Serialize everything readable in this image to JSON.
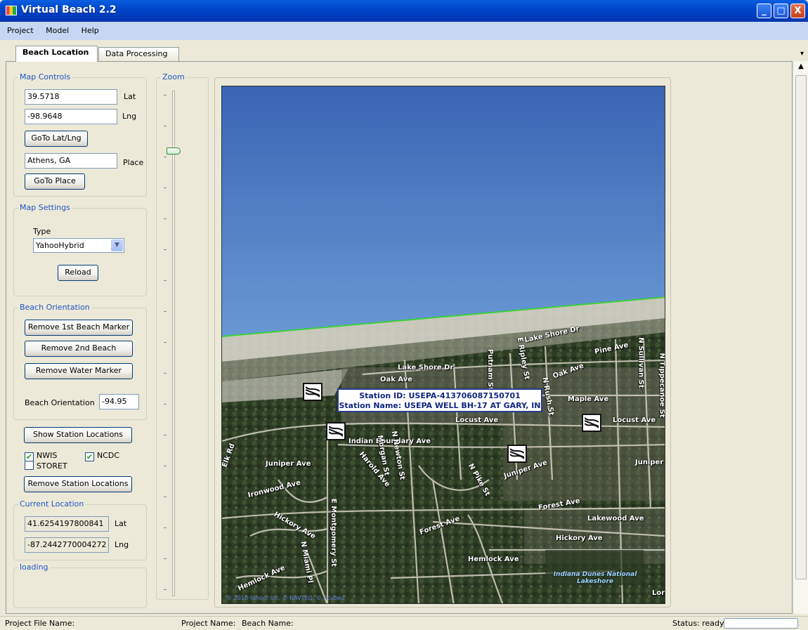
{
  "window": {
    "title": "Virtual Beach 2.2",
    "controls": [
      "_",
      "□",
      "X"
    ]
  },
  "menu": [
    "Project",
    "Model",
    "Help"
  ],
  "tabs": {
    "beach_location": "Beach Location",
    "data_processing": "Data Processing",
    "dropdown": "▾"
  },
  "map_controls": {
    "legend": "Map Controls",
    "lat_value": "39.5718",
    "lat_label": "Lat",
    "lng_value": "-98.9648",
    "lng_label": "Lng",
    "goto_latlng": "GoTo Lat/Lng",
    "place_value": "Athens, GA",
    "place_label": "Place",
    "goto_place": "GoTo Place"
  },
  "zoom": {
    "legend": "Zoom",
    "level_fraction": 0.12
  },
  "map_settings": {
    "legend": "Map Settings",
    "type_label": "Type",
    "type_value": "YahooHybrid",
    "reload": "Reload"
  },
  "beach_orientation": {
    "legend": "Beach Orientation",
    "remove_first": "Remove 1st Beach Marker",
    "remove_second": "Remove 2nd Beach",
    "remove_water": "Remove Water Marker",
    "orientation_label": "Beach Orientation",
    "orientation_value": "-94.95"
  },
  "stations": {
    "show": "Show Station Locations",
    "nwis": "NWIS",
    "nwis_checked": true,
    "ncdc": "NCDC",
    "ncdc_checked": true,
    "storet": "STORET",
    "storet_checked": false,
    "remove": "Remove Station Locations"
  },
  "current_location": {
    "legend": "Current Location",
    "lat_value": "41.6254197800841",
    "lat_label": "Lat",
    "lng_value": "-87.2442770004272",
    "lng_label": "Lng"
  },
  "loading": {
    "legend": "loading"
  },
  "map": {
    "tooltip_line1": "Station ID: USEPA-413706087150701",
    "tooltip_line2": "Station Name: USEPA WELL BH-17 AT GARY, IN",
    "streets": [
      "Lake Shore Dr",
      "Lake Shore Dr",
      "Oak Ave",
      "Oak Ave",
      "Maple Ave",
      "Locust Ave",
      "Locust Ave",
      "Indian Boundary Ave",
      "Juniper Ave",
      "Juniper Ave",
      "Juniper Ter",
      "Ironwood Ave",
      "Forest Ave",
      "Forest Ave",
      "Lakewood Ave",
      "Hickory Ave",
      "Hickory Ave",
      "Hemlock Ave",
      "Hemlock Ave",
      "Harold Ave",
      "N Pike St",
      "Morgan St",
      "N Newton St",
      "E Montgomery St",
      "N Miami Pl",
      "Putnam St",
      "E Ripley St",
      "N Rush St",
      "N Sullivan St",
      "N Tippecanoe St",
      "Pine Ave",
      "Elk Rd",
      "Lori"
    ],
    "park_label": "Indiana Dunes National Lakeshore",
    "copyright": "© 2010 Yahoo! Inc. © NAVTEQ, © i-cubed"
  },
  "status": {
    "project_file": "Project File Name:",
    "project_name": "Project Name:",
    "beach_name": "Beach Name:",
    "status_text": "Status: ready"
  }
}
